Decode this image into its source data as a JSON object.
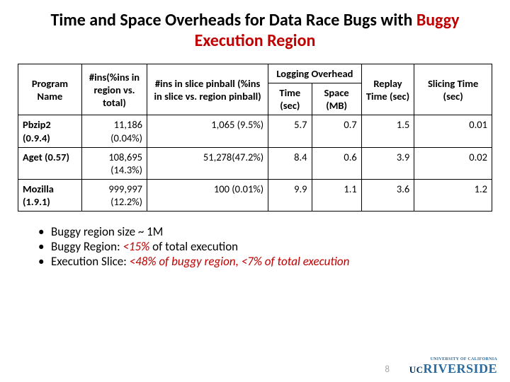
{
  "title_prefix": "Time and Space Overheads for Data Race Bugs with ",
  "title_buggy": "Buggy Execution Region",
  "headers": {
    "program": "Program Name",
    "ins": "#ins(%ins in region vs. total)",
    "pinball": "#ins in slice pinball (%ins in slice vs. region pinball)",
    "logging": "Logging Overhead",
    "log_time": "Time (sec)",
    "log_space": "Space (MB)",
    "replay": "Replay Time (sec)",
    "slice": "Slicing Time (sec)"
  },
  "rows": [
    {
      "prog": "Pbzip2 (0.9.4)",
      "ins": "11,186 (0.04%)",
      "pinball": "1,065 (9.5%)",
      "lt": "5.7",
      "ls": "0.7",
      "replay": "1.5",
      "slice": "0.01"
    },
    {
      "prog": "Aget (0.57)",
      "ins": "108,695 (14.3%)",
      "pinball": "51,278(47.2%)",
      "lt": "8.4",
      "ls": "0.6",
      "replay": "3.9",
      "slice": "0.02"
    },
    {
      "prog": "Mozilla (1.9.1)",
      "ins": "999,997 (12.2%)",
      "pinball": "100 (0.01%)",
      "lt": "9.9",
      "ls": "1.1",
      "replay": "3.6",
      "slice": "1.2"
    }
  ],
  "notes": {
    "n1": "Buggy region size ~ 1M",
    "n2a": "Buggy Region: ",
    "n2b": "<15% ",
    "n2c": "of total execution",
    "n3a": "Execution Slice:  ",
    "n3b": "<48%  of buggy region",
    "n3c": ", ",
    "n3d": "<7% ",
    "n3e": "of total execution"
  },
  "slidenum": "8",
  "logo": {
    "uc": "UC",
    "riv": "RIVERSIDE",
    "small": "UNIVERSITY OF CALIFORNIA"
  },
  "chart_data": {
    "type": "table",
    "title": "Time and Space Overheads for Data Race Bugs with Buggy Execution Region",
    "columns": [
      "Program Name",
      "#ins(%ins in region vs. total)",
      "#ins in slice pinball (%ins in slice vs. region pinball)",
      "Logging Time (sec)",
      "Logging Space (MB)",
      "Replay Time (sec)",
      "Slicing Time (sec)"
    ],
    "rows": [
      [
        "Pbzip2 (0.9.4)",
        "11,186 (0.04%)",
        "1,065 (9.5%)",
        5.7,
        0.7,
        1.5,
        0.01
      ],
      [
        "Aget (0.57)",
        "108,695 (14.3%)",
        "51,278 (47.2%)",
        8.4,
        0.6,
        3.9,
        0.02
      ],
      [
        "Mozilla (1.9.1)",
        "999,997 (12.2%)",
        "100 (0.01%)",
        9.9,
        1.1,
        3.6,
        1.2
      ]
    ]
  }
}
